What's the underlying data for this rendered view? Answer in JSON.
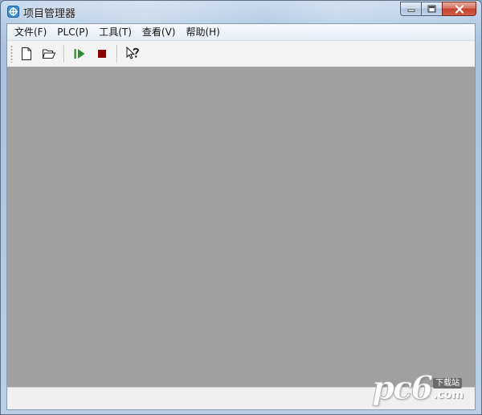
{
  "window": {
    "title": "项目管理器",
    "caption_buttons": [
      "minimize-icon",
      "maximize-icon",
      "close-icon"
    ]
  },
  "menubar": {
    "items": [
      {
        "label": "文件(F)"
      },
      {
        "label": "PLC(P)"
      },
      {
        "label": "工具(T)"
      },
      {
        "label": "查看(V)"
      },
      {
        "label": "帮助(H)"
      }
    ]
  },
  "toolbar": {
    "buttons": [
      {
        "icon": "new-file-icon"
      },
      {
        "icon": "open-folder-icon"
      },
      {
        "icon": "run-icon"
      },
      {
        "icon": "stop-icon"
      },
      {
        "icon": "help-pointer-icon"
      }
    ]
  },
  "colors": {
    "workspace": "#a0a0a0",
    "run_green": "#2e8b2e",
    "stop_red": "#8b0000",
    "close_red": "#c4412a"
  },
  "watermark": {
    "logo": "pc6",
    "cn": "下载站",
    "suffix": ".com"
  }
}
